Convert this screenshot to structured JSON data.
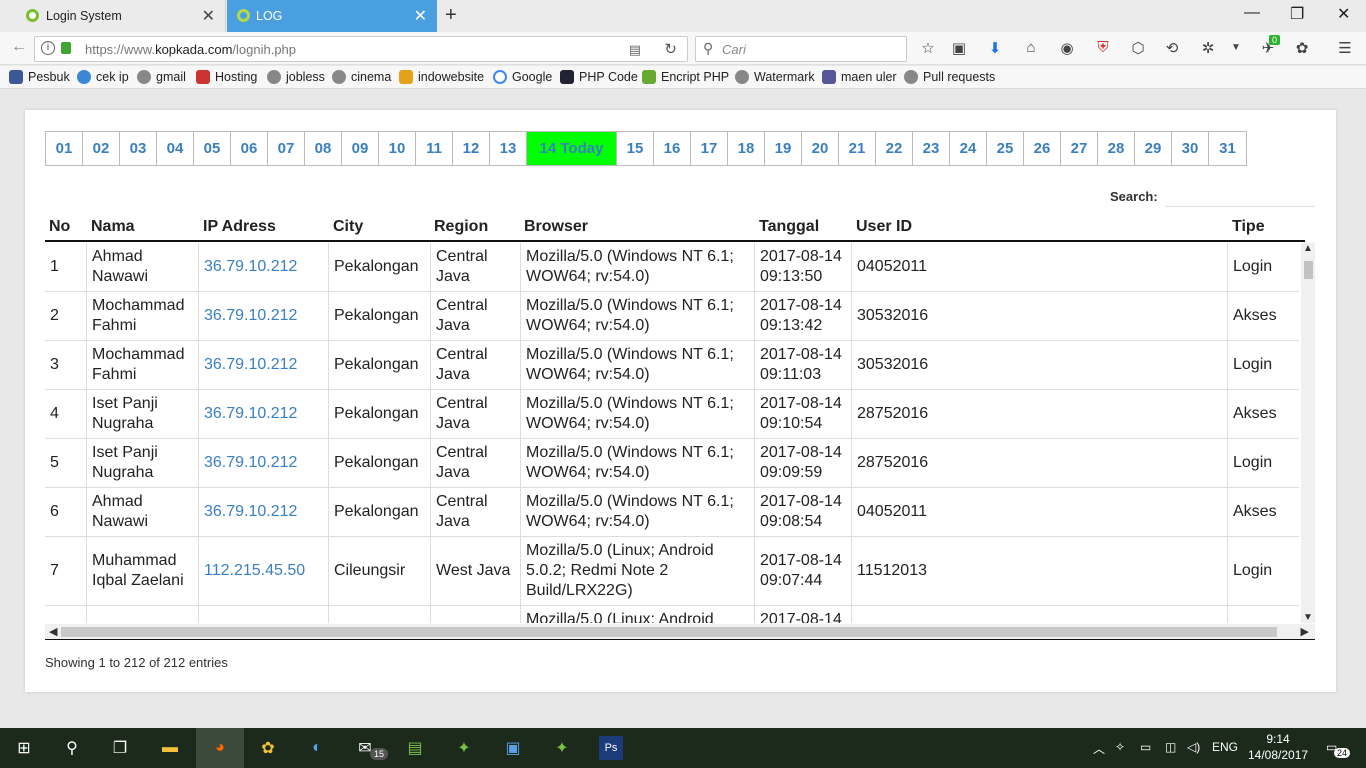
{
  "browser": {
    "tabs": [
      {
        "label": "Login System",
        "active": false
      },
      {
        "label": "LOG",
        "active": true
      }
    ],
    "url_prefix": "https://www.",
    "url_domain": "kopkada.com",
    "url_path": "/lognih.php",
    "search_placeholder": "Cari",
    "badge_count": "0",
    "bookmarks": [
      "Pesbuk",
      "cek ip",
      "gmail",
      "Hosting",
      "jobless",
      "cinema",
      "indowebsite",
      "Google",
      "PHP Code",
      "Encript PHP",
      "Watermark",
      "maen uler",
      "Pull requests"
    ]
  },
  "days": [
    "01",
    "02",
    "03",
    "04",
    "05",
    "06",
    "07",
    "08",
    "09",
    "10",
    "11",
    "12",
    "13",
    "14 Today",
    "15",
    "16",
    "17",
    "18",
    "19",
    "20",
    "21",
    "22",
    "23",
    "24",
    "25",
    "26",
    "27",
    "28",
    "29",
    "30",
    "31"
  ],
  "today_color": "#00ff00",
  "link_color": "#3a7fc1",
  "search_label": "Search:",
  "columns": [
    "No",
    "Nama",
    "IP Adress",
    "City",
    "Region",
    "Browser",
    "Tanggal",
    "User ID",
    "Tipe"
  ],
  "rows": [
    {
      "no": "1",
      "nama": "Ahmad Nawawi",
      "ip": "36.79.10.212",
      "city": "Pekalongan",
      "region": "Central Java",
      "browser": "Mozilla/5.0 (Windows NT 6.1; WOW64; rv:54.0)",
      "tanggal": "2017-08-14 09:13:50",
      "userid": "04052011",
      "tipe": "Login"
    },
    {
      "no": "2",
      "nama": "Mochammad Fahmi",
      "ip": "36.79.10.212",
      "city": "Pekalongan",
      "region": "Central Java",
      "browser": "Mozilla/5.0 (Windows NT 6.1; WOW64; rv:54.0)",
      "tanggal": "2017-08-14 09:13:42",
      "userid": "30532016",
      "tipe": "Akses"
    },
    {
      "no": "3",
      "nama": "Mochammad Fahmi",
      "ip": "36.79.10.212",
      "city": "Pekalongan",
      "region": "Central Java",
      "browser": "Mozilla/5.0 (Windows NT 6.1; WOW64; rv:54.0)",
      "tanggal": "2017-08-14 09:11:03",
      "userid": "30532016",
      "tipe": "Login"
    },
    {
      "no": "4",
      "nama": "Iset Panji Nugraha",
      "ip": "36.79.10.212",
      "city": "Pekalongan",
      "region": "Central Java",
      "browser": "Mozilla/5.0 (Windows NT 6.1; WOW64; rv:54.0)",
      "tanggal": "2017-08-14 09:10:54",
      "userid": "28752016",
      "tipe": "Akses"
    },
    {
      "no": "5",
      "nama": "Iset Panji Nugraha",
      "ip": "36.79.10.212",
      "city": "Pekalongan",
      "region": "Central Java",
      "browser": "Mozilla/5.0 (Windows NT 6.1; WOW64; rv:54.0)",
      "tanggal": "2017-08-14 09:09:59",
      "userid": "28752016",
      "tipe": "Login"
    },
    {
      "no": "6",
      "nama": "Ahmad Nawawi",
      "ip": "36.79.10.212",
      "city": "Pekalongan",
      "region": "Central Java",
      "browser": "Mozilla/5.0 (Windows NT 6.1; WOW64; rv:54.0)",
      "tanggal": "2017-08-14 09:08:54",
      "userid": "04052011",
      "tipe": "Akses"
    },
    {
      "no": "7",
      "nama": "Muhammad Iqbal Zaelani",
      "ip": "112.215.45.50",
      "city": "Cileungsir",
      "region": "West Java",
      "browser": "Mozilla/5.0 (Linux; Android 5.0.2; Redmi Note 2 Build/LRX22G)",
      "tanggal": "2017-08-14 09:07:44",
      "userid": "11512013",
      "tipe": "Login"
    },
    {
      "no": "",
      "nama": "",
      "ip": "",
      "city": "",
      "region": "",
      "browser": "Mozilla/5.0 (Linux; Android",
      "tanggal": "2017-08-14",
      "userid": "",
      "tipe": ""
    }
  ],
  "info_text": "Showing 1 to 212 of 212 entries",
  "taskbar": {
    "mail_badge": "15",
    "lang": "ENG",
    "time": "9:14",
    "date": "14/08/2017",
    "notif_count": "24"
  }
}
